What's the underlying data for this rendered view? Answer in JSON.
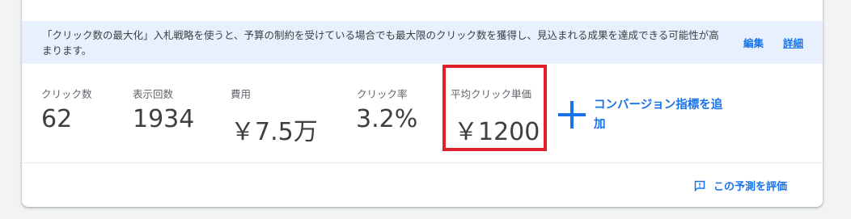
{
  "banner": {
    "text": "「クリック数の最大化」入札戦略を使うと、予算の制約を受けている場合でも最大限のクリック数を獲得し、見込まれる成果を達成できる可能性が高まります。",
    "edit_label": "編集",
    "details_label": "詳細"
  },
  "metrics": [
    {
      "label": "クリック数",
      "value": "62"
    },
    {
      "label": "表示回数",
      "value": "1934"
    },
    {
      "label": "費用",
      "value": "￥7.5万"
    },
    {
      "label": "クリック率",
      "value": "3.2%"
    },
    {
      "label": "平均クリック単価",
      "value": "￥1200"
    }
  ],
  "add_conversion": {
    "icon": "plus-icon",
    "label": "コンバージョン指標を追加"
  },
  "footer": {
    "icon": "feedback-icon",
    "rate_label": "この予測を評価"
  },
  "colors": {
    "accent": "#1a73e8",
    "banner_bg": "#e8f0fe",
    "highlight": "#e0202a"
  }
}
